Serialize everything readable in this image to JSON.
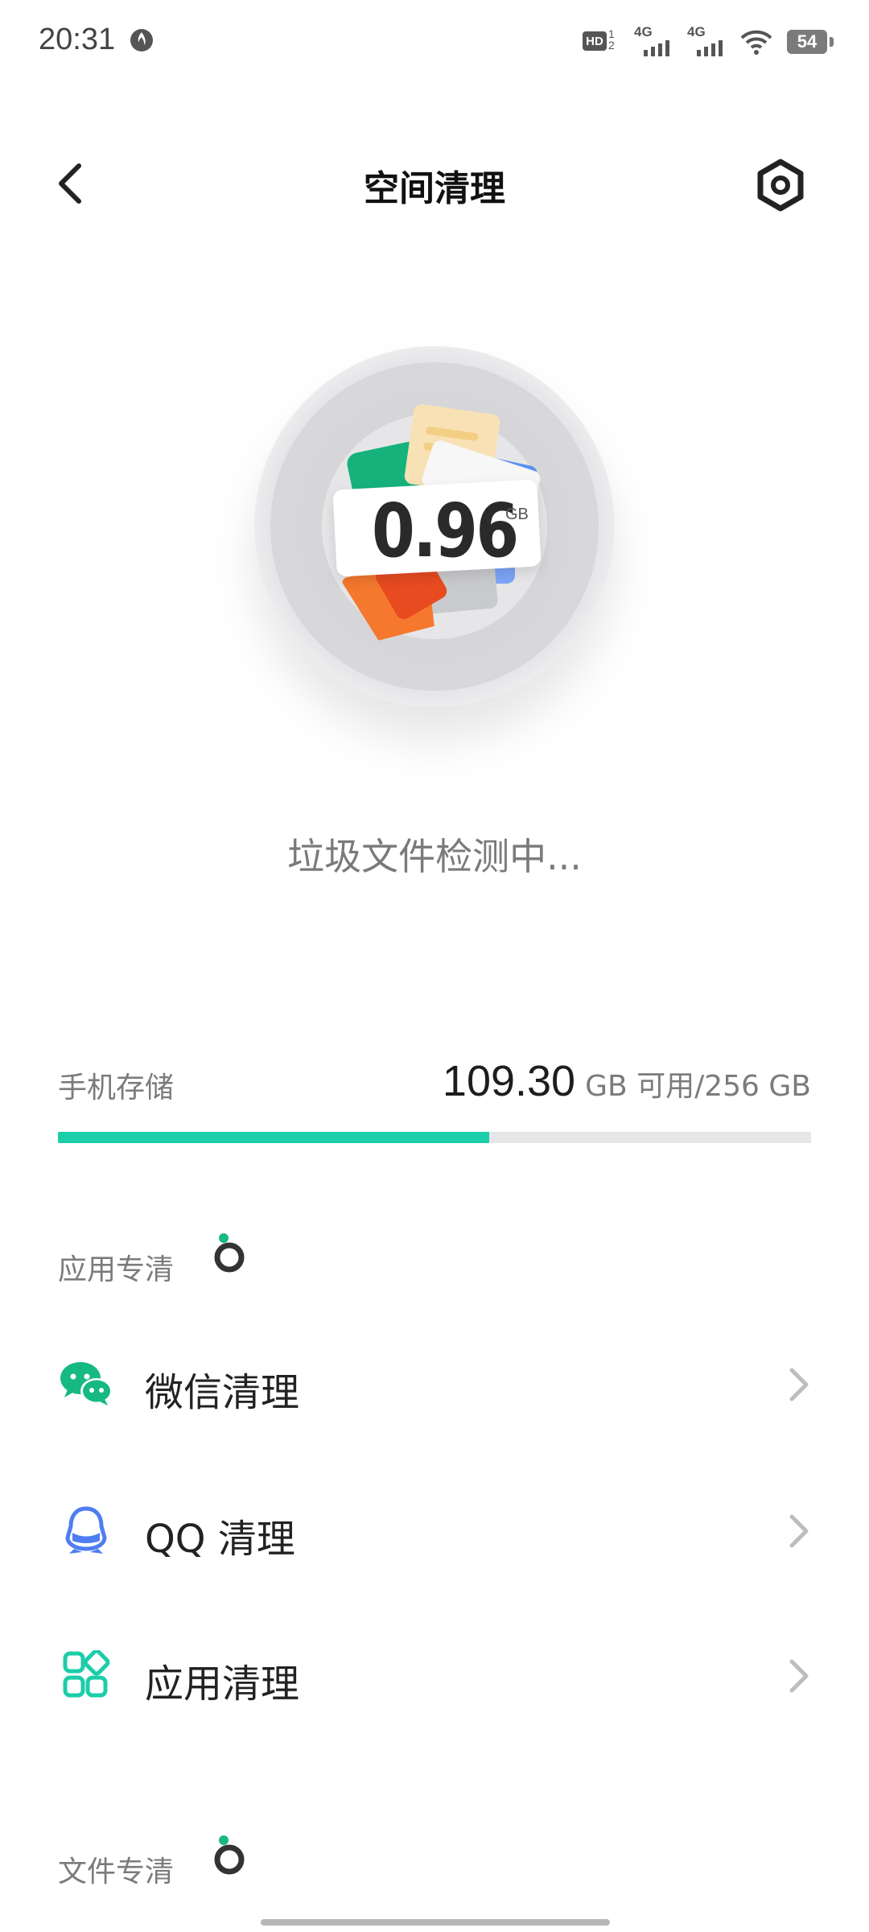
{
  "status_bar": {
    "time": "20:31",
    "moon_icon": "flame-icon",
    "hd_label": "HD",
    "net1_label": "4G",
    "net2_label": "4G",
    "battery": "54"
  },
  "header": {
    "title": "空间清理",
    "back_icon": "chevron-left-icon",
    "settings_icon": "settings-hex-icon"
  },
  "scan": {
    "junk_size": "0.96",
    "junk_unit": "GB",
    "status": "垃圾文件检测中..."
  },
  "storage": {
    "label": "手机存储",
    "available": "109.30",
    "available_suffix": "GB 可用/256 GB",
    "used_fraction": 0.573,
    "bar_color": "#1ccdaa"
  },
  "sections": [
    {
      "title": "应用专清",
      "items": [
        {
          "label": "微信清理",
          "icon": "wechat-icon",
          "color": "#16b981"
        },
        {
          "label": "QQ 清理",
          "icon": "qq-icon",
          "color": "#4f7df1"
        },
        {
          "label": "应用清理",
          "icon": "app-grid-icon",
          "color": "#1ccdaa"
        }
      ]
    },
    {
      "title": "文件专清",
      "items": []
    }
  ],
  "colors": {
    "accent": "#1ccdaa",
    "badge_dot": "#16b981"
  }
}
